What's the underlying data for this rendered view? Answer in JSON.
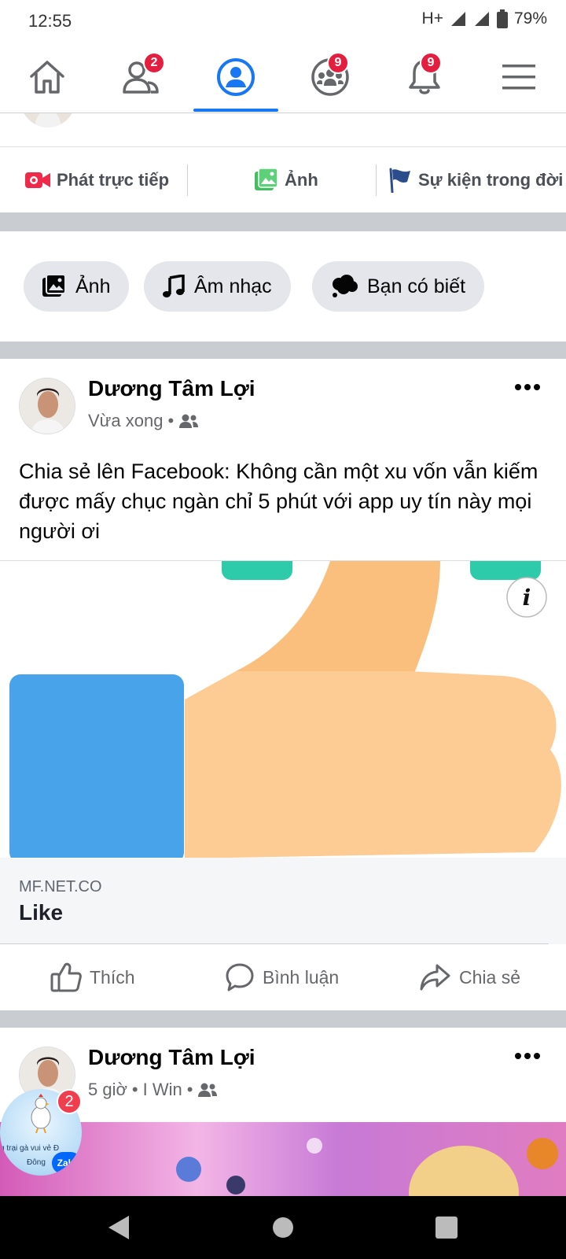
{
  "status_bar": {
    "time": "12:55",
    "network": "H+",
    "battery": "79%"
  },
  "top_nav": {
    "friends_badge": "2",
    "groups_badge": "9",
    "notifications_badge": "9"
  },
  "create_actions": {
    "live": "Phát trực tiếp",
    "photo": "Ảnh",
    "life_event": "Sự kiện trong đời"
  },
  "chips": {
    "photo": "Ảnh",
    "music": "Âm nhạc",
    "did_you_know": "Bạn có biết"
  },
  "post1": {
    "author": "Dương Tâm Lợi",
    "time": "Vừa xong",
    "separator": "•",
    "text": "Chia sẻ lên Facebook: Không cần một xu vốn vẫn kiếm được mấy chục ngàn chỉ 5 phút với app uy tín này mọi người ơi",
    "link_domain": "MF.NET.CO",
    "link_title": "Like",
    "info_icon_label": "i"
  },
  "post_actions": {
    "like": "Thích",
    "comment": "Bình luận",
    "share": "Chia sẻ"
  },
  "post2": {
    "author": "Dương Tâm Lợi",
    "time": "5 giờ",
    "app": "I Win",
    "separator": "•"
  },
  "zalo_bubble": {
    "text_line1": "g trại gà vui vẻ Đ",
    "text_line2": "Đông",
    "logo": "Zalo",
    "badge": "2"
  },
  "colors": {
    "accent": "#1877f2",
    "badge": "#e41e3f",
    "secondary_text": "#65676b",
    "band": "#c9ccd1",
    "chip_bg": "#e4e6eb"
  }
}
